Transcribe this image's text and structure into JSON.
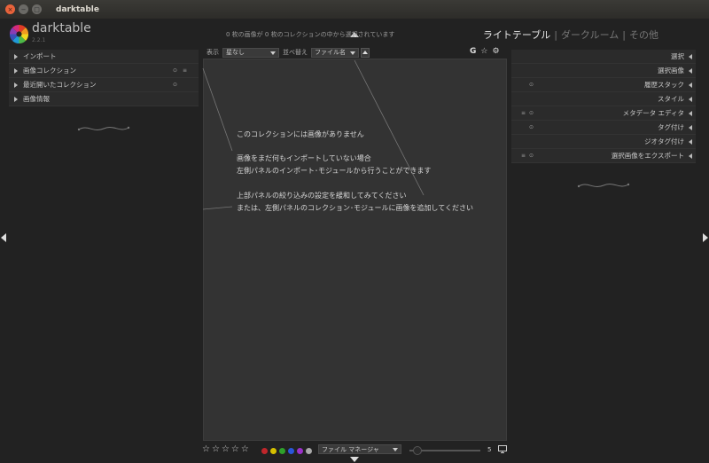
{
  "window": {
    "title": "darktable",
    "close_glyph": "×",
    "minimize_glyph": "−",
    "maximize_glyph": "□"
  },
  "header": {
    "brand": "darktable",
    "version": "2.2.1",
    "collection_count": "0 枚の画像が 0 枚のコレクションの中から選択されています",
    "views": {
      "lighttable": "ライトテーブル",
      "darkroom": "ダークルーム",
      "other": "その他",
      "separator": "|"
    }
  },
  "filterbar": {
    "view_label": "表示",
    "view_value": "星なし",
    "sort_label": "並べ替え",
    "sort_value": "ファイル名",
    "right_icons": [
      "G",
      "☆",
      "⚙"
    ]
  },
  "left_panel": {
    "items": [
      {
        "label": "インポート",
        "icons": []
      },
      {
        "label": "画像コレクション",
        "icons": [
          "⊙",
          "≡"
        ]
      },
      {
        "label": "最近開いたコレクション",
        "icons": [
          "⊙"
        ]
      },
      {
        "label": "画像情報",
        "icons": []
      }
    ]
  },
  "right_panel": {
    "items": [
      {
        "label": "選択",
        "icons": []
      },
      {
        "label": "選択画像",
        "icons": []
      },
      {
        "label": "履歴スタック",
        "icons": [
          "⊙"
        ]
      },
      {
        "label": "スタイル",
        "icons": []
      },
      {
        "label": "メタデータ エディタ",
        "icons": [
          "≡",
          "⊙"
        ]
      },
      {
        "label": "タグ付け",
        "icons": [
          "⊙"
        ]
      },
      {
        "label": "ジオタグ付け",
        "icons": []
      },
      {
        "label": "選択画像をエクスポート",
        "icons": [
          "≡",
          "⊙"
        ]
      }
    ]
  },
  "center": {
    "messages": [
      "このコレクションには画像がありません",
      "画像をまだ何もインポートしていない場合",
      "左側パネルのインポート･モジュールから行うことができます",
      "上部パネルの絞り込みの設定を緩和してみてください",
      "または、左側パネルのコレクション･モジュールに画像を追加してください"
    ]
  },
  "bottombar": {
    "stars": [
      "☆",
      "☆",
      "☆",
      "☆",
      "☆"
    ],
    "color_labels": [
      "#c0262b",
      "#d6c000",
      "#2fa12b",
      "#2a56d9",
      "#9b31c9",
      "#aaaaaa"
    ],
    "layout_value": "ファイル マネージャ",
    "zoom_value": "5"
  }
}
